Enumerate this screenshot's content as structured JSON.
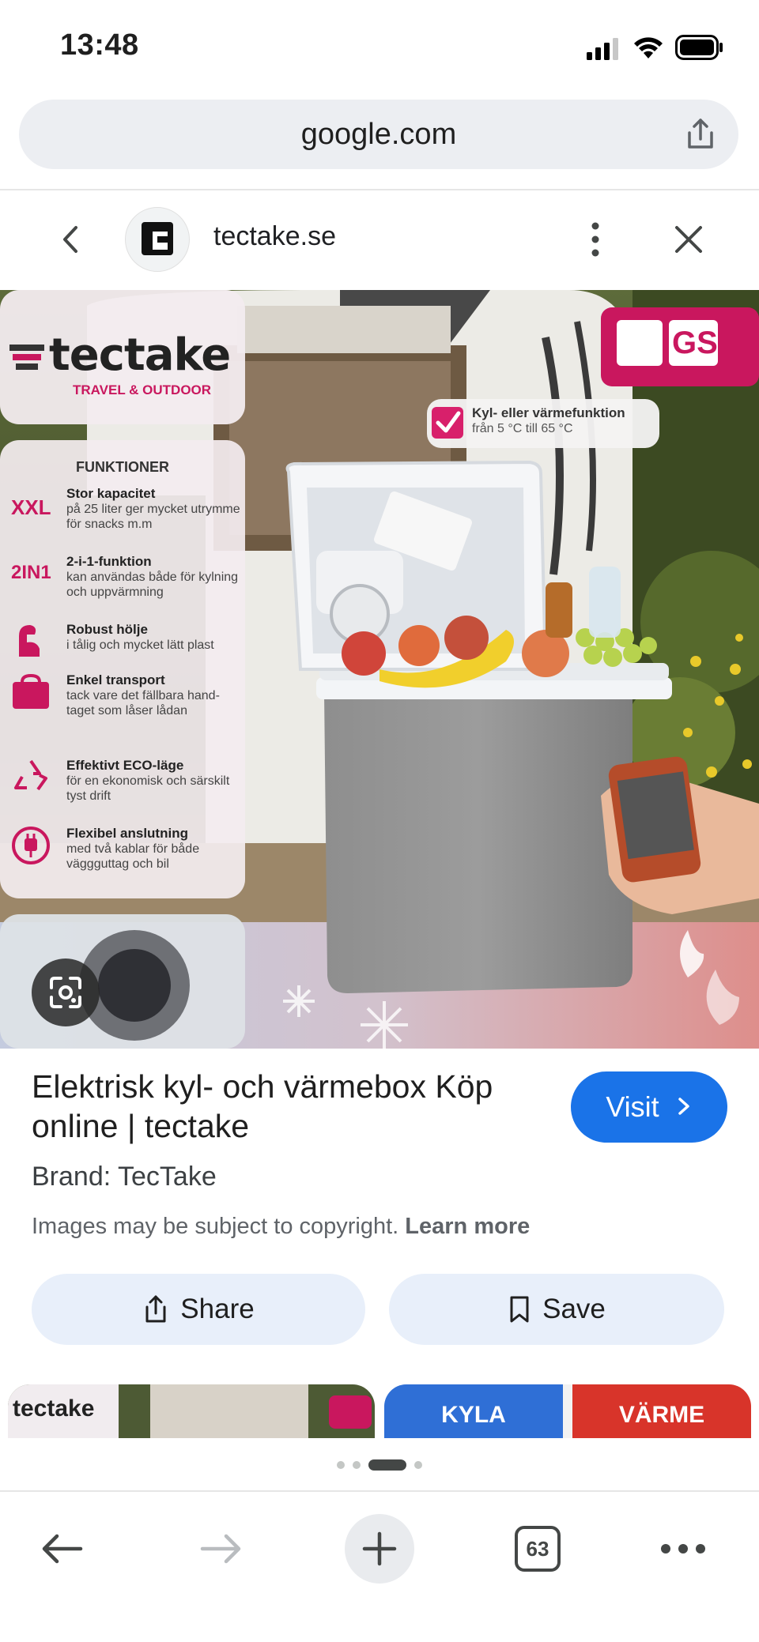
{
  "status_bar": {
    "time": "13:48"
  },
  "url_bar": {
    "domain": "google.com"
  },
  "source": {
    "site_name": "tectake.se"
  },
  "image": {
    "brand_logo_text": "tectake",
    "brand_tagline": "TRAVEL & OUTDOOR",
    "features_heading": "FUNKTIONER",
    "features": [
      {
        "badge": "XXL",
        "title": "Stor kapacitet",
        "text": "på 25 liter ger mycket utrymme för snacks m.m"
      },
      {
        "badge": "2IN1",
        "title": "2-i-1-funktion",
        "text": "kan användas både för kylning och uppvärmning"
      },
      {
        "badge": "",
        "title": "Robust hölje",
        "text": "i tålig och mycket lätt plast"
      },
      {
        "badge": "",
        "title": "Enkel transport",
        "text": "tack vare det fällbara hand-taget som låser lådan"
      },
      {
        "badge": "",
        "title": "Effektivt ECO-läge",
        "text": "för en ekonomisk och särskilt tyst drift"
      },
      {
        "badge": "",
        "title": "Flexibel anslutning",
        "text": "med två kablar för både väggguttag och bil"
      }
    ],
    "callout_title": "Kyl- eller värmefunktion",
    "callout_text": "från 5 °C till 65 °C",
    "cert_mark": "GS"
  },
  "result": {
    "title": "Elektrisk kyl- och värmebox Köp online | tectake",
    "brand": "Brand: TecTake",
    "copyright_text": "Images may be subject to copyright.",
    "learn_more": "Learn more",
    "visit_label": "Visit",
    "share_label": "Share",
    "save_label": "Save"
  },
  "related": {
    "item1_logo": "tectake",
    "item2_left": "KYLA",
    "item2_right": "VÄRME"
  },
  "bottom_nav": {
    "tab_count": "63"
  }
}
